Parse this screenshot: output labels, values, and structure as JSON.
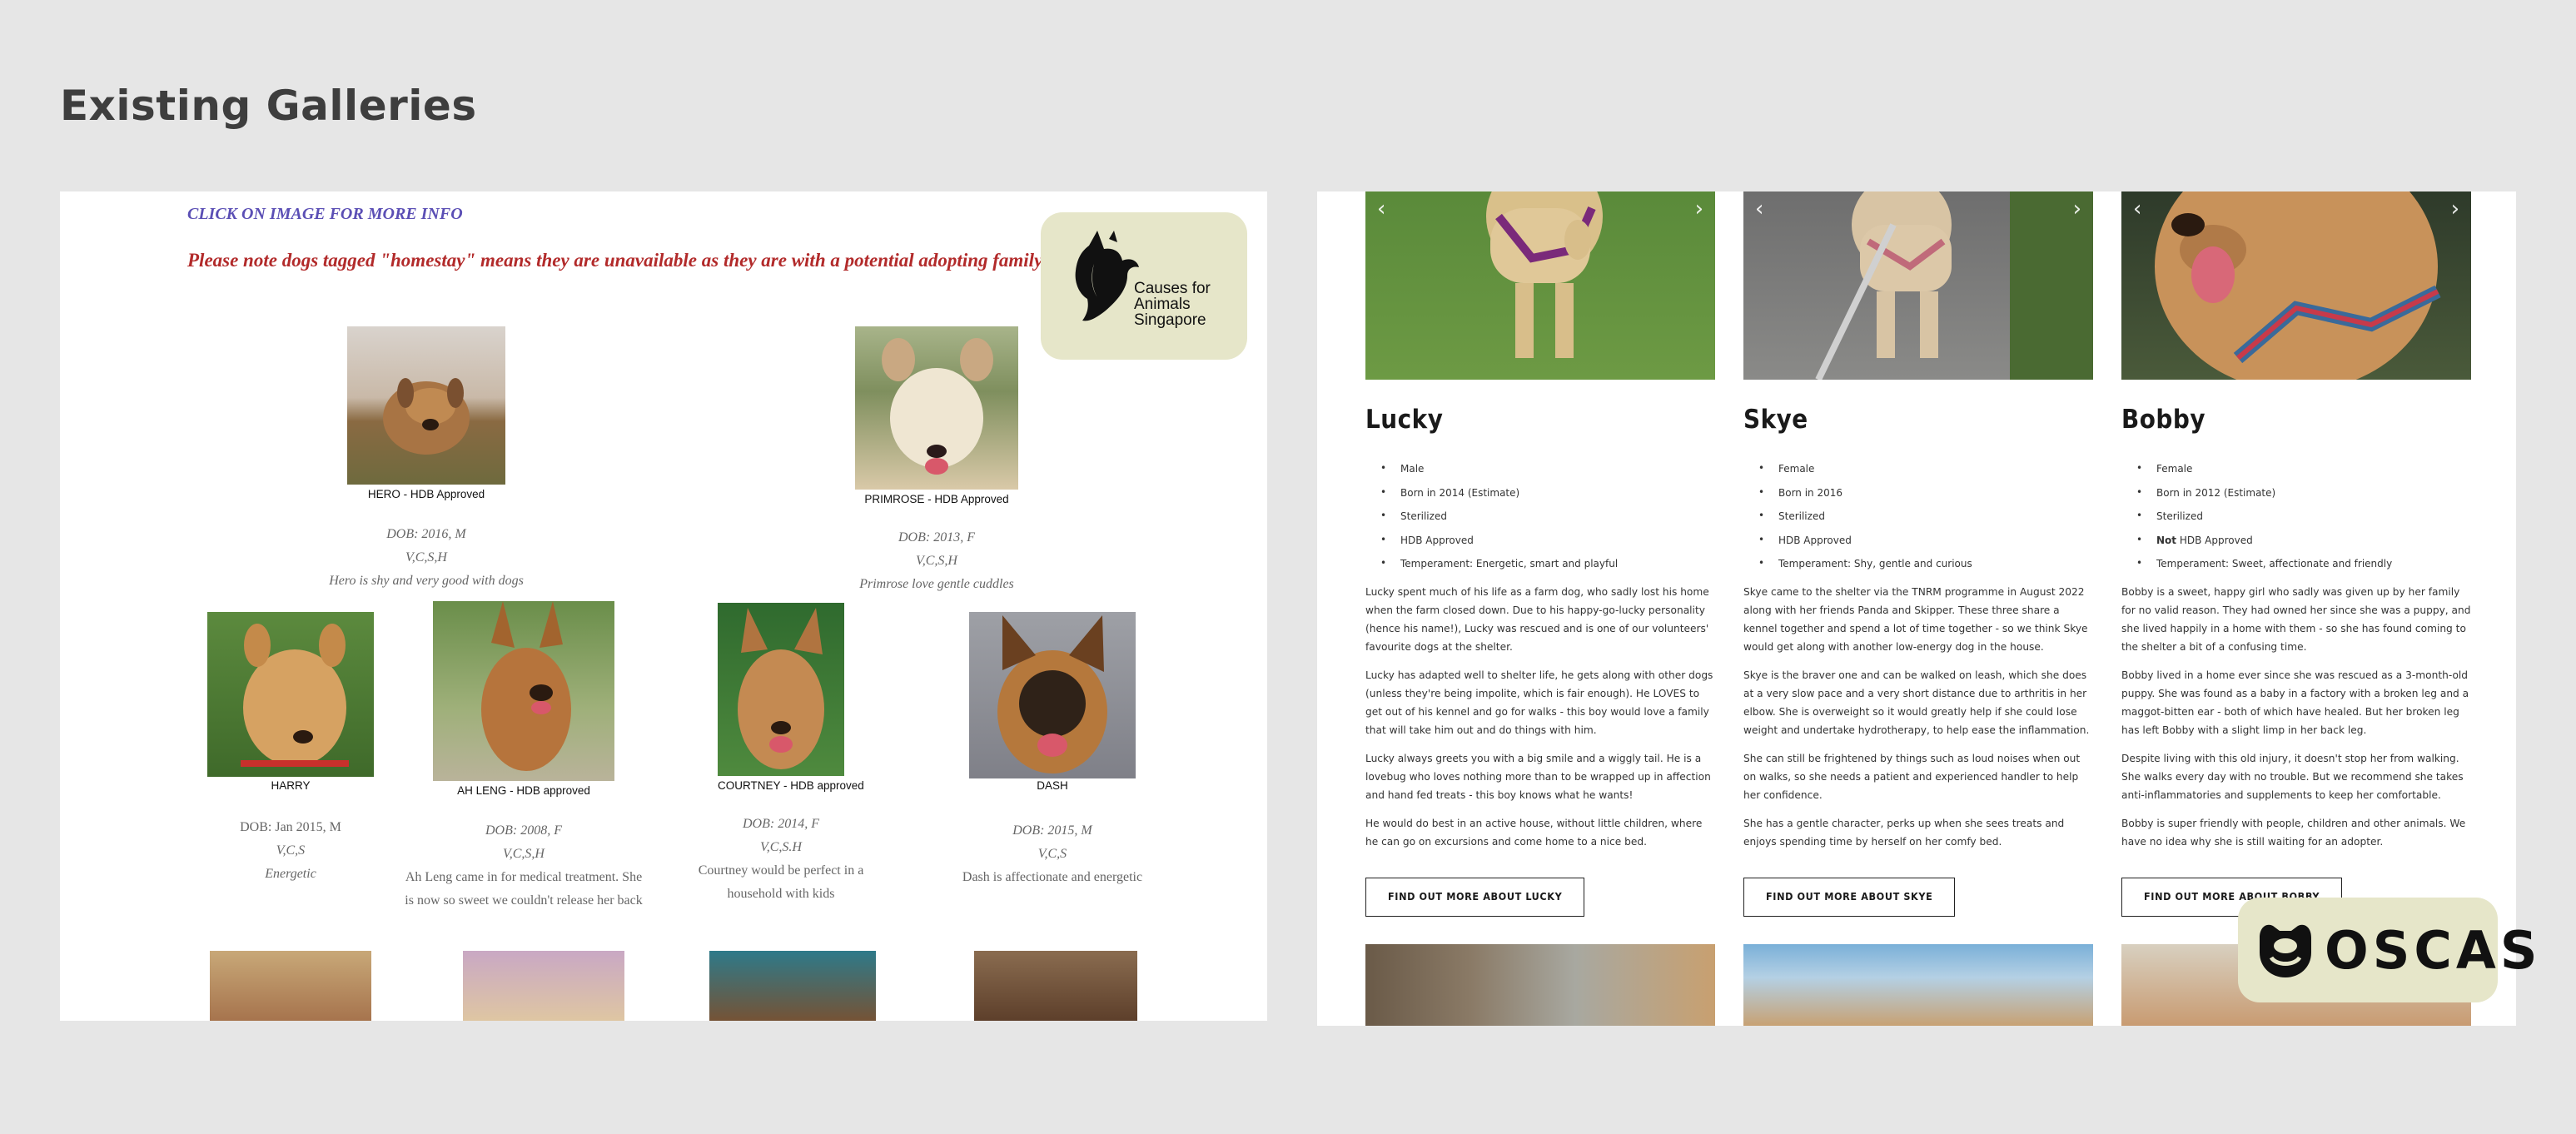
{
  "page": {
    "title": "Existing Galleries"
  },
  "left": {
    "cta": "CLICK ON IMAGE FOR MORE INFO",
    "note": "Please note dogs tagged  \"homestay\" means they are unavailable as they are with a potential adopting family",
    "logo": {
      "line1": "Causes for",
      "line2": "Animals",
      "line3": "Singapore"
    },
    "dogs": [
      {
        "caption": "HERO - HDB Approved",
        "dob": "DOB: 2016,  M",
        "vcs": "V,C,S,H",
        "desc": "Hero is shy and very good with dogs"
      },
      {
        "caption": "PRIMROSE - HDB Approved",
        "dob": "DOB: 2013,  F",
        "vcs": "V,C,S,H",
        "desc": "Primrose love gentle cuddles"
      },
      {
        "caption": "HARRY",
        "dob": "DOB: Jan 2015, M",
        "vcs": "V,C,S",
        "desc": "Energetic"
      },
      {
        "caption": "AH LENG - HDB approved",
        "dob": "DOB: 2008, F",
        "vcs": "V,C,S,H",
        "desc": "Ah Leng came in for medical treatment. She is now so sweet we couldn't release her back"
      },
      {
        "caption": "COURTNEY - HDB approved",
        "dob": "DOB: 2014, F",
        "vcs": "V,C,S.H",
        "desc": "Courtney would be perfect in a household with kids"
      },
      {
        "caption": "DASH",
        "dob": "DOB: 2015, M",
        "vcs": "V,C,S",
        "desc": "Dash is affectionate and energetic"
      }
    ]
  },
  "right": {
    "cards": [
      {
        "name": "Lucky",
        "facts": [
          "Male",
          "Born in 2014 (Estimate)",
          "Sterilized",
          "HDB Approved",
          "Temperament: Energetic, smart and playful"
        ],
        "paras": [
          "Lucky spent much of his life as a farm dog, who sadly lost his home when the farm closed down. Due to his happy-go-lucky personality (hence his name!), Lucky was rescued and is one of our volunteers' favourite dogs at the shelter.",
          "Lucky has adapted well to shelter life, he gets along with other dogs (unless they're being impolite, which is fair enough). He LOVES to get out of his kennel and go for walks - this boy would love a family that will take him out and do things with him.",
          "Lucky always greets you with a big smile and a wiggly tail. He is a lovebug who loves nothing more than to be wrapped up in affection and hand fed treats - this boy knows what he wants!",
          "He would do best in an active house, without little children, where he can go on excursions and come home to a nice bed."
        ],
        "button": "FIND OUT MORE ABOUT LUCKY"
      },
      {
        "name": "Skye",
        "facts": [
          "Female",
          "Born in 2016",
          "Sterilized",
          "HDB Approved",
          "Temperament: Shy, gentle and curious"
        ],
        "paras": [
          "Skye came to the shelter via the TNRM programme in August 2022 along with her friends Panda and Skipper. These three share a kennel together and spend a lot of time together - so we think Skye would get along with another low-energy dog in the house.",
          "Skye is the braver one and can be walked on leash, which she does at a very slow pace and a very short distance due to arthritis in her elbow. She is overweight so it would greatly help if she could lose weight and undertake hydrotherapy, to help ease the inflammation.",
          "She can still be frightened by things such as loud noises when out on walks, so she needs a patient and experienced handler to help her confidence.",
          "She has a gentle character, perks up when she sees treats and enjoys spending time by herself on her comfy bed."
        ],
        "button": "FIND OUT MORE ABOUT SKYE"
      },
      {
        "name": "Bobby",
        "facts": [
          "Female",
          "Born in 2012 (Estimate)",
          "Sterilized",
          "HDB Approved",
          "Temperament: Sweet, affectionate and friendly"
        ],
        "not_label": "Not",
        "paras": [
          "Bobby is a sweet, happy girl who sadly was given up by her family for no valid reason. They had owned her since she was a puppy, and she lived happily in a home with them - so she has found coming to the shelter a bit of a confusing time.",
          "Bobby lived in a home ever since she was rescued as a 3-month-old puppy. She was found as a baby in a factory with a broken leg and a maggot-bitten ear - both of which have healed. But her broken leg has left Bobby with a slight limp in her back leg.",
          "Despite living with this old injury, it doesn't stop her from walking. She walks every day with no trouble. But we recommend she takes anti-inflammatories and supplements to keep her comfortable.",
          "Bobby is super friendly with people, children and other animals. We have no idea why she is still waiting for an adopter."
        ],
        "button": "FIND OUT MORE ABOUT BOBBY"
      }
    ],
    "oscas_logo": "OSCAS"
  },
  "icons": {
    "prev": "chevron-left-icon",
    "next": "chevron-right-icon"
  },
  "colors": {
    "background": "#e6e6e6",
    "badge": "#e6e6c9",
    "cta": "#5b4fb5",
    "note": "#b22a2a"
  }
}
